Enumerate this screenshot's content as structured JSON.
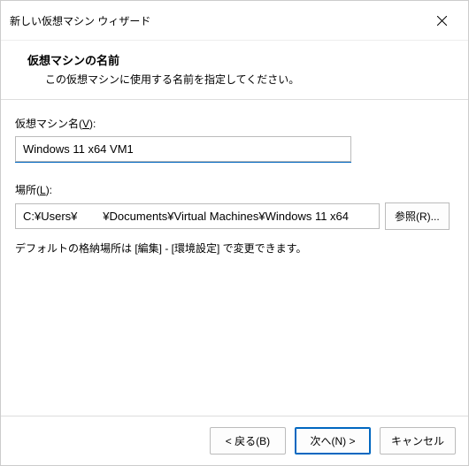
{
  "window": {
    "title": "新しい仮想マシン ウィザード"
  },
  "header": {
    "title": "仮想マシンの名前",
    "subtitle": "この仮想マシンに使用する名前を指定してください。"
  },
  "fields": {
    "name": {
      "label_pre": "仮想マシン名(",
      "label_accel": "V",
      "label_post": "):",
      "value": "Windows 11 x64 VM1"
    },
    "location": {
      "label_pre": "場所(",
      "label_accel": "L",
      "label_post": "):",
      "value": "C:¥Users¥        ¥Documents¥Virtual Machines¥Windows 11 x64",
      "browse_pre": "参照(",
      "browse_accel": "R",
      "browse_post": ")..."
    },
    "hint": "デフォルトの格納場所は [編集] - [環境設定] で変更できます。"
  },
  "footer": {
    "back_pre": "< 戻る(",
    "back_accel": "B",
    "back_post": ")",
    "next_pre": "次へ(",
    "next_accel": "N",
    "next_post": ") >",
    "cancel": "キャンセル"
  }
}
